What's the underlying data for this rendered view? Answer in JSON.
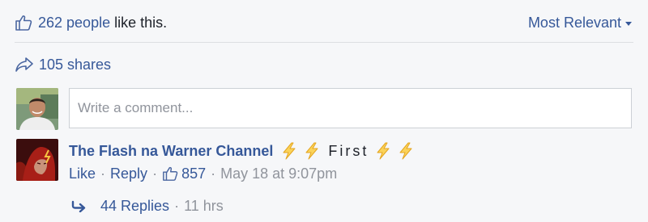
{
  "likes": {
    "count_text": "262 people",
    "suffix": "like this."
  },
  "sort": {
    "label": "Most Relevant"
  },
  "shares": {
    "label": "105 shares"
  },
  "composer": {
    "placeholder": "Write a comment..."
  },
  "comment": {
    "author": "The Flash na Warner Channel",
    "text": "First",
    "actions": {
      "like": "Like",
      "reply": "Reply",
      "like_count": "857",
      "timestamp": "May 18 at 9:07pm"
    }
  },
  "replies": {
    "label": "44 Replies",
    "age": "11 hrs"
  },
  "icons": {
    "like": "thumbs-up-icon",
    "share": "share-arrow-icon",
    "bolt": "lightning-bolt-emoji",
    "reply": "reply-arrow-icon"
  },
  "colors": {
    "link": "#365899",
    "text": "#1d2129",
    "muted": "#90949c",
    "bolt": "#f5b52a"
  }
}
